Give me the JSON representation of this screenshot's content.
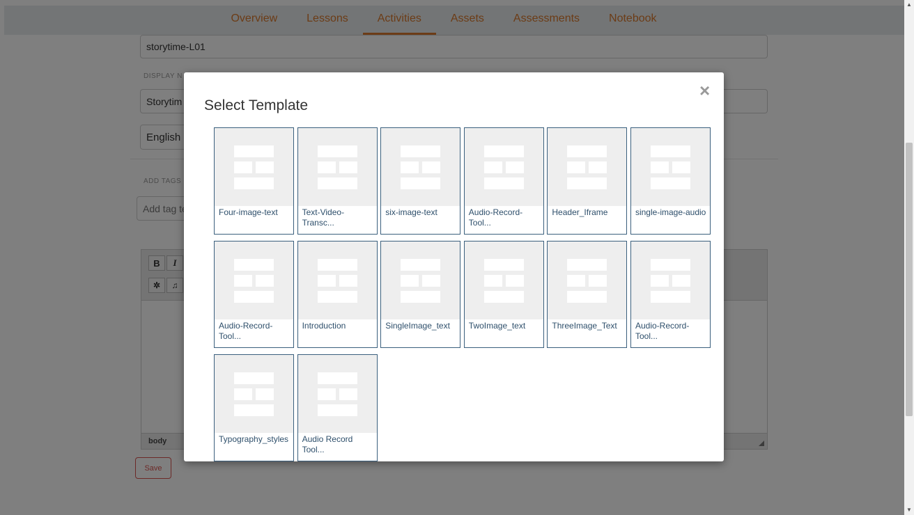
{
  "nav": {
    "tabs": [
      {
        "label": "Overview"
      },
      {
        "label": "Lessons"
      },
      {
        "label": "Activities",
        "active": true
      },
      {
        "label": "Assets"
      },
      {
        "label": "Assessments"
      },
      {
        "label": "Notebook"
      }
    ],
    "accent_color": "#d9782c"
  },
  "form": {
    "name_value": "storytime-L01",
    "display_label": "DISPLAY N",
    "display_value": "Storytim",
    "language_value": "English",
    "tags_label": "ADD TAGS",
    "tags_placeholder": "Add tag te",
    "editor": {
      "bold": "B",
      "italic": "I",
      "image_icon": "image-icon",
      "music_icon": "music-icon",
      "status_path": "body"
    },
    "save_label": "Save"
  },
  "modal": {
    "title": "Select Template",
    "close_glyph": "×",
    "templates": [
      {
        "label": "Four-image-text"
      },
      {
        "label": "Text-Video-Transc..."
      },
      {
        "label": "six-image-text"
      },
      {
        "label": "Audio-Record-Tool..."
      },
      {
        "label": "Header_Iframe"
      },
      {
        "label": "single-image-audio"
      },
      {
        "label": "Audio-Record-Tool..."
      },
      {
        "label": "Introduction"
      },
      {
        "label": "SingleImage_text"
      },
      {
        "label": "TwoImage_text"
      },
      {
        "label": "ThreeImage_Text"
      },
      {
        "label": "Audio-Record-Tool..."
      },
      {
        "label": "Typography_styles"
      },
      {
        "label": "Audio Record Tool..."
      }
    ]
  }
}
